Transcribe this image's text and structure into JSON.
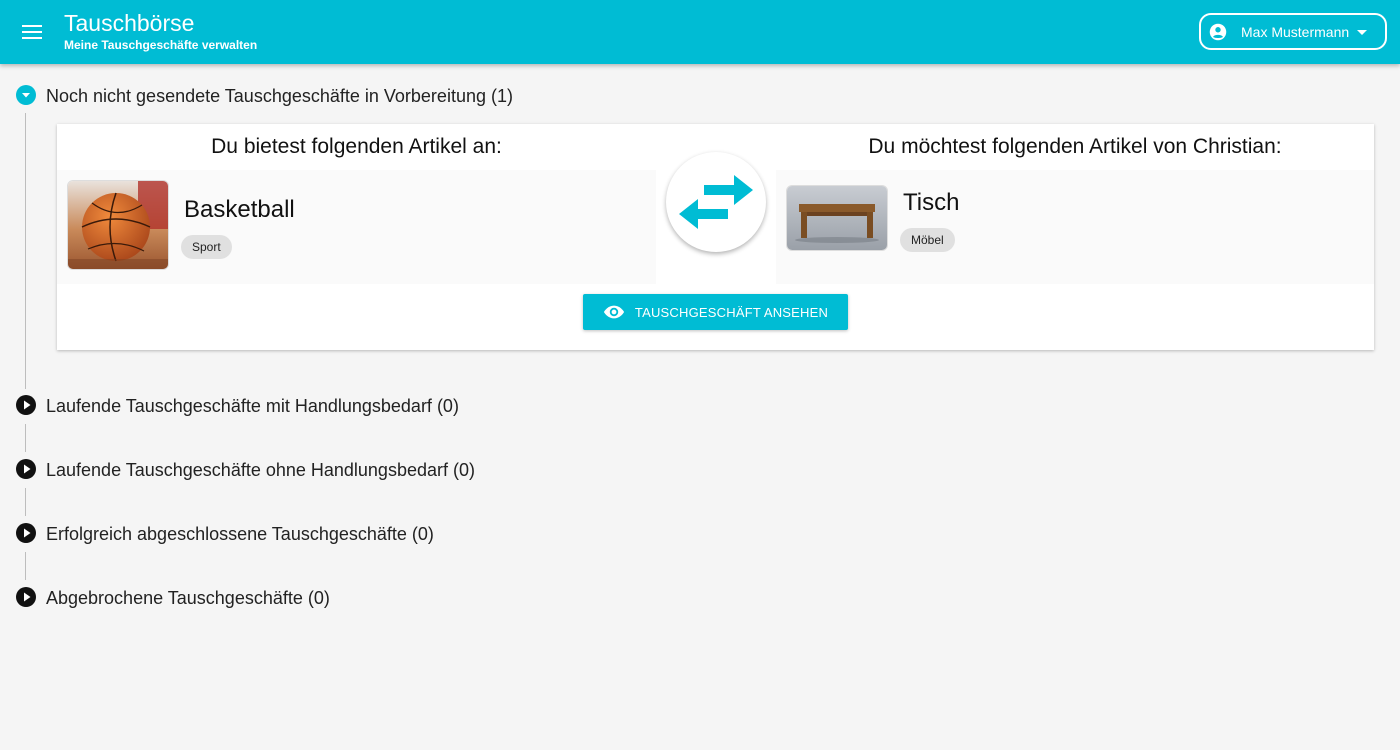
{
  "app": {
    "title": "Tauschbörse",
    "subtitle": "Meine Tauschgeschäfte verwalten",
    "user_name": "Max Mustermann",
    "accent_color": "#00bcd4"
  },
  "sections": [
    {
      "label": "Noch nicht gesendete Tauschgeschäfte in Vorbereitung (1)",
      "expanded": true
    },
    {
      "label": "Laufende Tauschgeschäfte mit Handlungsbedarf (0)",
      "expanded": false
    },
    {
      "label": "Laufende Tauschgeschäfte ohne Handlungsbedarf (0)",
      "expanded": false
    },
    {
      "label": "Erfolgreich abgeschlossene Tauschgeschäfte (0)",
      "expanded": false
    },
    {
      "label": "Abgebrochene Tauschgeschäfte (0)",
      "expanded": false
    }
  ],
  "trade": {
    "offer_heading": "Du bietest folgenden Artikel an:",
    "offer_item": {
      "name": "Basketball",
      "category": "Sport",
      "image": "basketball photo"
    },
    "want_heading": "Du möchtest folgenden Artikel von Christian:",
    "want_item": {
      "name": "Tisch",
      "category": "Möbel",
      "image": "wooden table photo"
    },
    "swap_icon": "swap-arrows-icon",
    "view_button": "TAUSCHGESCHÄFT ANSEHEN"
  }
}
